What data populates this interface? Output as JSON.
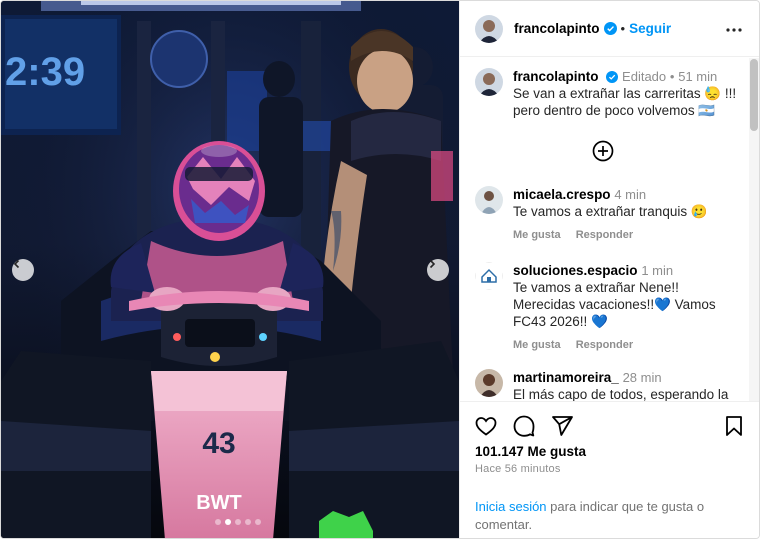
{
  "post": {
    "username": "francolapinto",
    "follow_label": "Seguir",
    "separator": "•"
  },
  "photo": {
    "display_time": "2:39",
    "car_number": "43",
    "sponsor_text": "BWT",
    "carousel_dots": 5,
    "active_dot": 1
  },
  "caption": {
    "username": "francolapinto",
    "edited": "Editado",
    "separator": "•",
    "time": "51 min",
    "line1": "Se van a extrañar las carreritas 😓 !!!",
    "line2": "pero dentro de poco volvemos 🇦🇷"
  },
  "comments": [
    {
      "username": "micaela.crespo",
      "time": "4 min",
      "text": "Te vamos a extrañar tranquis 🥲",
      "like_label": "Me gusta",
      "reply_label": "Responder"
    },
    {
      "username": "soluciones.espacio",
      "time": "1 min",
      "text_lines": [
        "Te vamos a extrañar Nene!!",
        "Merecidas vacaciones!!💙 Vamos",
        "FC43 2026!! 💙"
      ],
      "like_label": "Me gusta",
      "reply_label": "Responder"
    },
    {
      "username": "martinamoreira_",
      "time": "28 min",
      "text": "El más capo de todos, esperando la"
    }
  ],
  "footer": {
    "likes": "101.147 Me gusta",
    "time_ago": "Hace 56 minutos",
    "login_link": "Inicia sesión",
    "login_text": " para indicar que te gusta o comentar."
  },
  "icons": {
    "heart": "heart-icon",
    "comment": "comment-icon",
    "share": "share-icon",
    "save": "bookmark-icon",
    "more": "more-icon",
    "verified": "verified-badge-icon",
    "load_more": "plus-circle-icon"
  },
  "colors": {
    "link_blue": "#0095f6",
    "meta_gray": "#8e8e8e",
    "verified_blue": "#0095f6",
    "car_pink": "#e9a0bd"
  }
}
